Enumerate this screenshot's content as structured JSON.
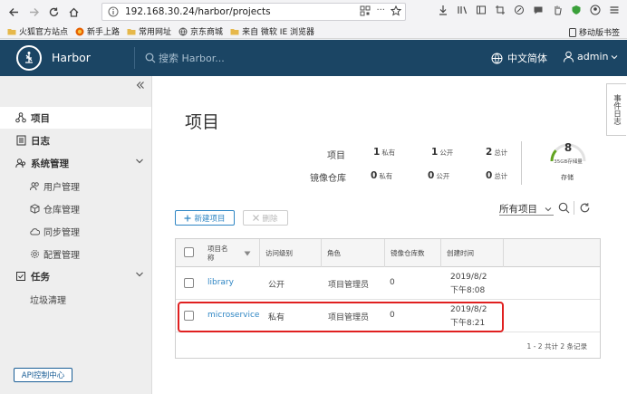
{
  "browser": {
    "url_host": "192.168.30.24",
    "url_path": "/harbor/projects",
    "bookmarks": [
      "火狐官方站点",
      "新手上路",
      "常用网址",
      "京东商城",
      "来自 微软 IE 浏览器"
    ],
    "mobile_bookmarks": "移动版书签"
  },
  "header": {
    "brand": "Harbor",
    "search_placeholder": "搜索 Harbor...",
    "language": "中文简体",
    "user": "admin"
  },
  "sidebar": {
    "projects": "项目",
    "logs": "日志",
    "admin": "系统管理",
    "admin_items": [
      "用户管理",
      "仓库管理",
      "同步管理",
      "配置管理"
    ],
    "tasks": "任务",
    "tasks_items": [
      "垃圾清理"
    ],
    "api_center": "API控制中心"
  },
  "event_log_tab": "事件日志",
  "page": {
    "title": "项目",
    "stats": {
      "projects_label": "项目",
      "repos_label": "镜像仓库",
      "private_label": "私有",
      "public_label": "公开",
      "total_label": "总计",
      "projects_private": "1",
      "projects_public": "1",
      "projects_total": "2",
      "repos_private": "0",
      "repos_public": "0",
      "repos_total": "0"
    },
    "storage": {
      "count": "8",
      "quota": "35GB存储量",
      "label": "存储",
      "used_fraction": 0.23
    },
    "new_project": "新建项目",
    "delete": "删除",
    "filter_value": "所有项目"
  },
  "table": {
    "columns": [
      "项目名称",
      "访问级别",
      "角色",
      "镜像仓库数",
      "创建时间"
    ],
    "rows": [
      {
        "name": "library",
        "access": "公开",
        "role": "项目管理员",
        "repos": "0",
        "date": "2019/8/2",
        "time": "下午8:08"
      },
      {
        "name": "microservice",
        "access": "私有",
        "role": "项目管理员",
        "repos": "0",
        "date": "2019/8/2",
        "time": "下午8:21"
      }
    ],
    "footer": "1 - 2 共计 2 条记录"
  },
  "colors": {
    "header_bg": "#1b4564",
    "link": "#2f86c4",
    "highlight": "#e02020"
  }
}
